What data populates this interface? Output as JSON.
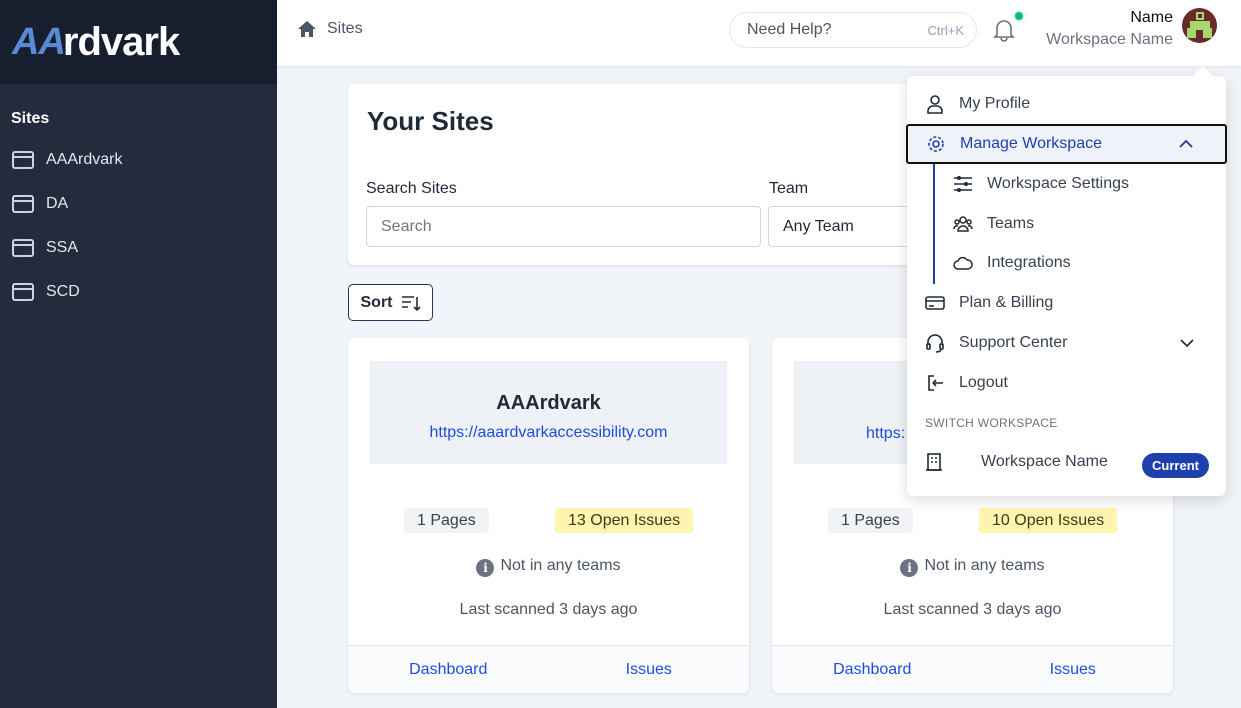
{
  "brand": {
    "logo": "AAArdvark"
  },
  "sidebar": {
    "heading": "Sites",
    "items": [
      {
        "label": "AAArdvark"
      },
      {
        "label": "DA"
      },
      {
        "label": "SSA"
      },
      {
        "label": "SCD"
      }
    ]
  },
  "header": {
    "breadcrumb": "Sites",
    "help_placeholder": "Need Help?",
    "help_shortcut": "Ctrl+K",
    "user_name": "Name",
    "workspace_name": "Workspace Name",
    "notification_dot_color": "#10b981"
  },
  "panel": {
    "title": "Your Sites",
    "search_label": "Search Sites",
    "search_placeholder": "Search",
    "team_label": "Team",
    "team_value": "Any Team"
  },
  "sort_label": "Sort",
  "cards": [
    {
      "title": "AAArdvark",
      "url": "https://aaardvarkaccessibility.com",
      "pages": "1 Pages",
      "issues": "13 Open Issues",
      "teams": "Not in any teams",
      "scanned": "Last scanned 3 days ago",
      "dashboard": "Dashboard",
      "issues_link": "Issues"
    },
    {
      "title": "",
      "url": "https:",
      "pages": "1 Pages",
      "issues": "10 Open Issues",
      "teams": "Not in any teams",
      "scanned": "Last scanned 3 days ago",
      "dashboard": "Dashboard",
      "issues_link": "Issues"
    }
  ],
  "menu": {
    "my_profile": "My Profile",
    "manage_workspace": "Manage Workspace",
    "workspace_settings": "Workspace Settings",
    "teams": "Teams",
    "integrations": "Integrations",
    "plan_billing": "Plan & Billing",
    "support_center": "Support Center",
    "logout": "Logout",
    "switch_heading": "SWITCH WORKSPACE",
    "workspace": "Workspace Name",
    "current_badge": "Current"
  }
}
